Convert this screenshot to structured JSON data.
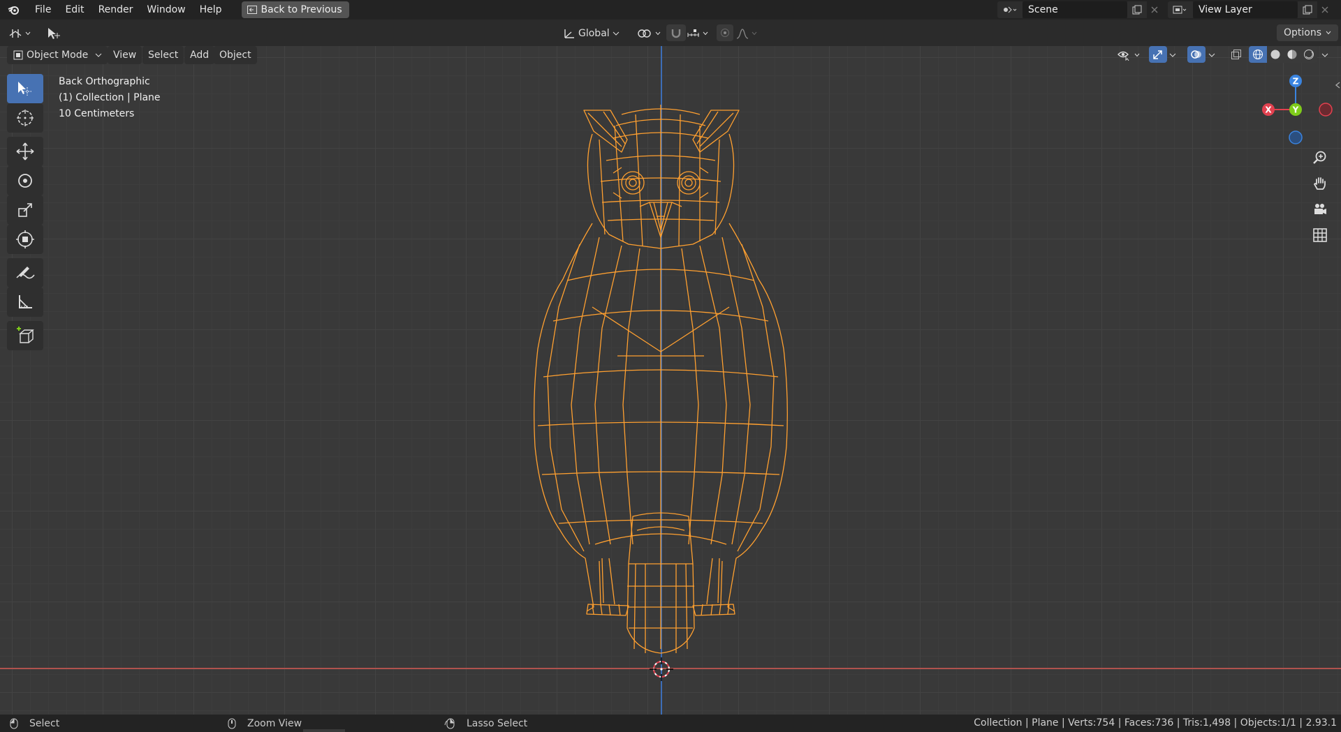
{
  "menu": {
    "items": [
      "File",
      "Edit",
      "Render",
      "Window",
      "Help"
    ],
    "back_button": "Back to Previous"
  },
  "scene": {
    "name": "Scene",
    "view_layer": "View Layer"
  },
  "toolbar": {
    "transform_orientation": "Global",
    "options": "Options"
  },
  "viewport_header": {
    "mode": "Object Mode",
    "menus": [
      "View",
      "Select",
      "Add",
      "Object"
    ]
  },
  "overlay_info": {
    "view": "Back Orthographic",
    "collection": "(1) Collection | Plane",
    "scale": "10 Centimeters"
  },
  "gizmo": {
    "z": "Z",
    "y": "Y",
    "x": "X"
  },
  "status": {
    "left": "Select",
    "middle": "Zoom View",
    "right": "Lasso Select",
    "stats": "Collection | Plane | Verts:754 | Faces:736 | Tris:1,498 | Objects:1/1 | 2.93.1"
  },
  "colors": {
    "wire": "#ffa030",
    "accent": "#4772b3",
    "x_axis": "#e2414f",
    "y_axis": "#7fcc1a",
    "z_axis": "#3a84e0"
  }
}
